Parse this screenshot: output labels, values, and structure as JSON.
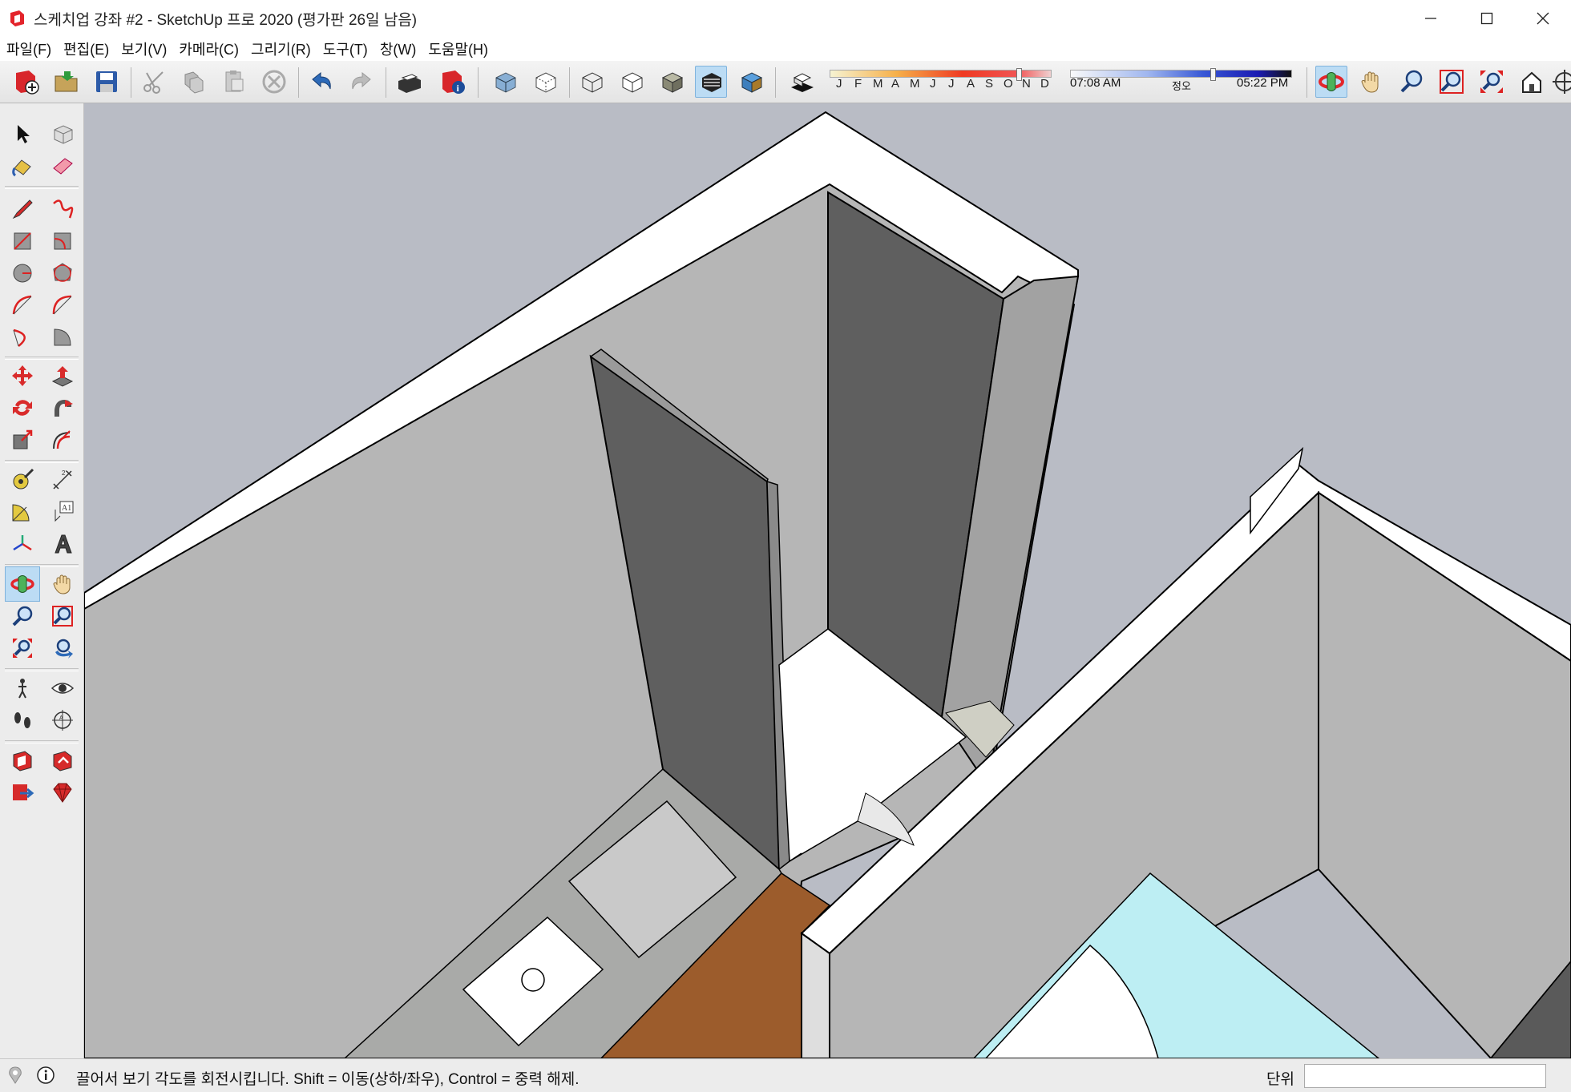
{
  "window": {
    "title": "스케치업 강좌 #2 - SketchUp 프로 2020 (평가판 26일 남음)"
  },
  "menu": [
    {
      "label": "파일(F)"
    },
    {
      "label": "편집(E)"
    },
    {
      "label": "보기(V)"
    },
    {
      "label": "카메라(C)"
    },
    {
      "label": "그리기(R)"
    },
    {
      "label": "도구(T)"
    },
    {
      "label": "창(W)"
    },
    {
      "label": "도움말(H)"
    }
  ],
  "shadows": {
    "months": [
      "J",
      "F",
      "M",
      "A",
      "M",
      "J",
      "J",
      "A",
      "S",
      "O",
      "N",
      "D"
    ],
    "time_start": "07:08 AM",
    "time_mid": "정오",
    "time_end": "05:22 PM"
  },
  "status": {
    "message": "끌어서 보기 각도를 회전시킵니다. Shift = 이동(상하/좌우), Control = 중력 해제.",
    "units_label": "단위"
  },
  "colors": {
    "viewport_bg": "#b9bcc5",
    "wall_light": "#b7b7b7",
    "wall_dark": "#5f5f5f",
    "wall_top": "#ffffff",
    "floor_wood": "#9c5c2c",
    "floor_marble": "#a9aaa8",
    "floor_tile": "#bdeef3",
    "active_tool": "#bcdcf4"
  }
}
